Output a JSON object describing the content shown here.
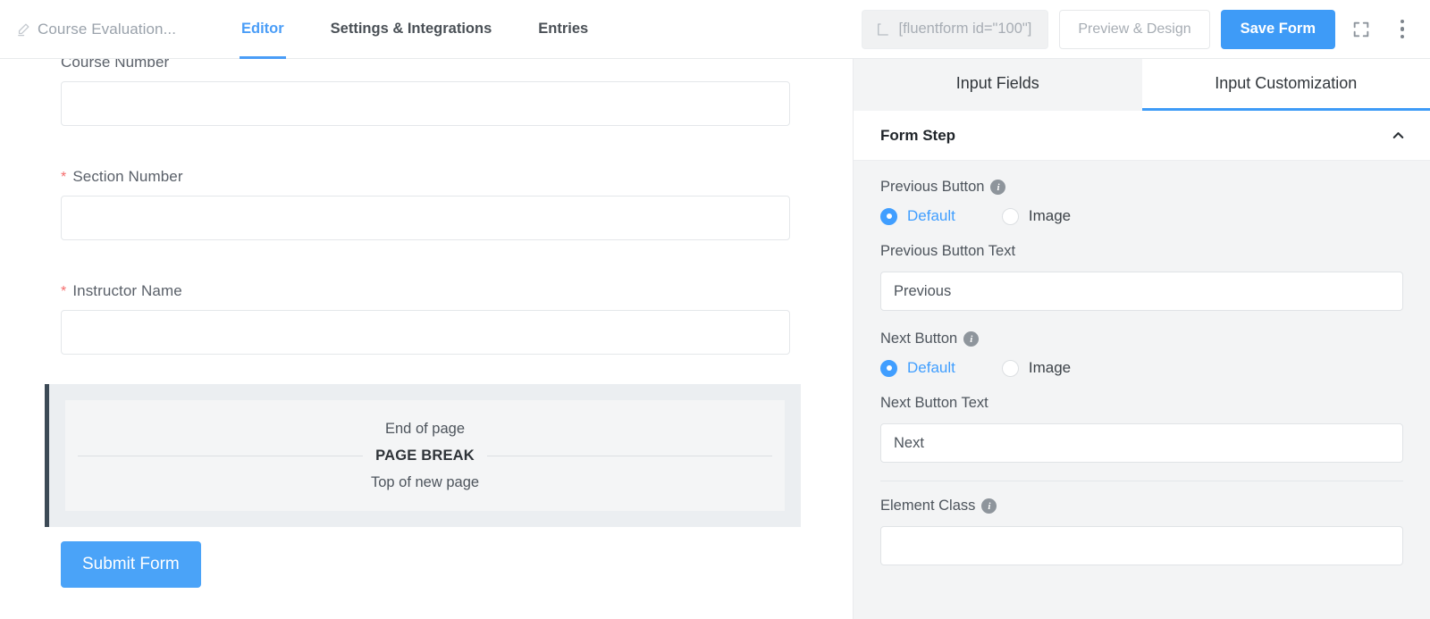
{
  "header": {
    "form_title": "Course Evaluation...",
    "pencil_icon": "pencil-icon",
    "nav": [
      {
        "label": "Editor",
        "active": true
      },
      {
        "label": "Settings & Integrations",
        "active": false
      },
      {
        "label": "Entries",
        "active": false
      }
    ],
    "shortcode": "[fluentform id=\"100\"]",
    "shortcode_icon": "shortcode-bracket-icon",
    "preview_label": "Preview & Design",
    "save_label": "Save Form",
    "fullscreen_icon": "fullscreen-icon",
    "more_icon": "more-vertical-icon",
    "accent_color": "#3e9bf7"
  },
  "canvas": {
    "fields": [
      {
        "label": "Course Number",
        "required": false,
        "value": ""
      },
      {
        "label": "Section Number",
        "required": true,
        "value": ""
      },
      {
        "label": "Instructor Name",
        "required": true,
        "value": ""
      }
    ],
    "page_break": {
      "top_text": "End of page",
      "label": "PAGE BREAK",
      "bottom_text": "Top of new page",
      "accent_color": "#3c4a56"
    },
    "submit_label": "Submit Form",
    "submit_color": "#4aa3f8"
  },
  "panel": {
    "tabs": [
      {
        "label": "Input Fields",
        "active": false
      },
      {
        "label": "Input Customization",
        "active": true
      }
    ],
    "section": {
      "title": "Form Step",
      "collapse_icon": "chevron-up-icon",
      "expanded": true
    },
    "settings": {
      "previous_button": {
        "label": "Previous Button",
        "info_icon": "info-icon",
        "options": [
          {
            "label": "Default",
            "checked": true
          },
          {
            "label": "Image",
            "checked": false
          }
        ],
        "text_label": "Previous Button Text",
        "text_value": "Previous",
        "text_placeholder": ""
      },
      "next_button": {
        "label": "Next Button",
        "info_icon": "info-icon",
        "options": [
          {
            "label": "Default",
            "checked": true
          },
          {
            "label": "Image",
            "checked": false
          }
        ],
        "text_label": "Next Button Text",
        "text_value": "Next",
        "text_placeholder": ""
      },
      "element_class": {
        "label": "Element Class",
        "info_icon": "info-icon",
        "value": "",
        "placeholder": ""
      }
    },
    "accent_color": "#409eff"
  }
}
